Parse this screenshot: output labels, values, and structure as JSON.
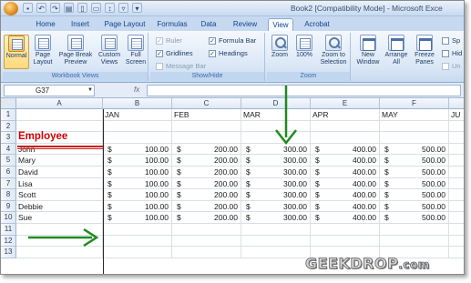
{
  "window": {
    "title": "Book2  [Compatibility Mode] - Microsoft Exce"
  },
  "tabs": [
    "Home",
    "Insert",
    "Page Layout",
    "Formulas",
    "Data",
    "Review",
    "View",
    "Acrobat"
  ],
  "active_tab": "View",
  "ribbon": {
    "workbook_views": {
      "label": "Workbook Views",
      "buttons": [
        {
          "label": "Normal"
        },
        {
          "label": "Page Layout"
        },
        {
          "label": "Page Break Preview"
        },
        {
          "label": "Custom Views"
        },
        {
          "label": "Full Screen"
        }
      ]
    },
    "show_hide": {
      "label": "Show/Hide",
      "checks": [
        {
          "label": "Ruler",
          "checked": true,
          "disabled": true
        },
        {
          "label": "Formula Bar",
          "checked": true,
          "disabled": false
        },
        {
          "label": "Gridlines",
          "checked": true,
          "disabled": false
        },
        {
          "label": "Headings",
          "checked": true,
          "disabled": false
        },
        {
          "label": "Message Bar",
          "checked": false,
          "disabled": true
        }
      ]
    },
    "zoom": {
      "label": "Zoom",
      "buttons": [
        {
          "label": "Zoom"
        },
        {
          "label": "100%"
        },
        {
          "label": "Zoom to Selection"
        }
      ]
    },
    "window_group": {
      "buttons": [
        {
          "label": "New Window"
        },
        {
          "label": "Arrange All"
        },
        {
          "label": "Freeze Panes"
        }
      ],
      "side_items": [
        "Sp",
        "Hid",
        "Un"
      ]
    }
  },
  "formula_bar": {
    "name_box": "G37",
    "fx": "fx",
    "value": ""
  },
  "sheet": {
    "columns": [
      "A",
      "B",
      "C",
      "D",
      "E",
      "F"
    ],
    "row_numbers": [
      "1",
      "2",
      "3",
      "4",
      "5",
      "6",
      "7",
      "8",
      "9",
      "10",
      "11",
      "12",
      "13"
    ],
    "months": [
      "JAN",
      "FEB",
      "MAR",
      "APR",
      "MAY",
      "JU"
    ],
    "title": "Employee",
    "currency_symbol": "$",
    "employees": [
      {
        "name": "John",
        "values": [
          "100.00",
          "200.00",
          "300.00",
          "400.00",
          "500.00"
        ]
      },
      {
        "name": "Mary",
        "values": [
          "100.00",
          "200.00",
          "300.00",
          "400.00",
          "500.00"
        ]
      },
      {
        "name": "David",
        "values": [
          "100.00",
          "200.00",
          "300.00",
          "400.00",
          "500.00"
        ]
      },
      {
        "name": "Lisa",
        "values": [
          "100.00",
          "200.00",
          "300.00",
          "400.00",
          "500.00"
        ]
      },
      {
        "name": "Scott",
        "values": [
          "100.00",
          "200.00",
          "300.00",
          "400.00",
          "500.00"
        ]
      },
      {
        "name": "Debbie",
        "values": [
          "100.00",
          "200.00",
          "300.00",
          "400.00",
          "500.00"
        ]
      },
      {
        "name": "Sue",
        "values": [
          "100.00",
          "200.00",
          "300.00",
          "400.00",
          "500.00"
        ]
      }
    ]
  },
  "annotations": {
    "arrow_color": "#1f8a1f",
    "title_color": "#d10000"
  },
  "watermark": {
    "text": "GEEKDROP",
    "suffix": ".com"
  }
}
